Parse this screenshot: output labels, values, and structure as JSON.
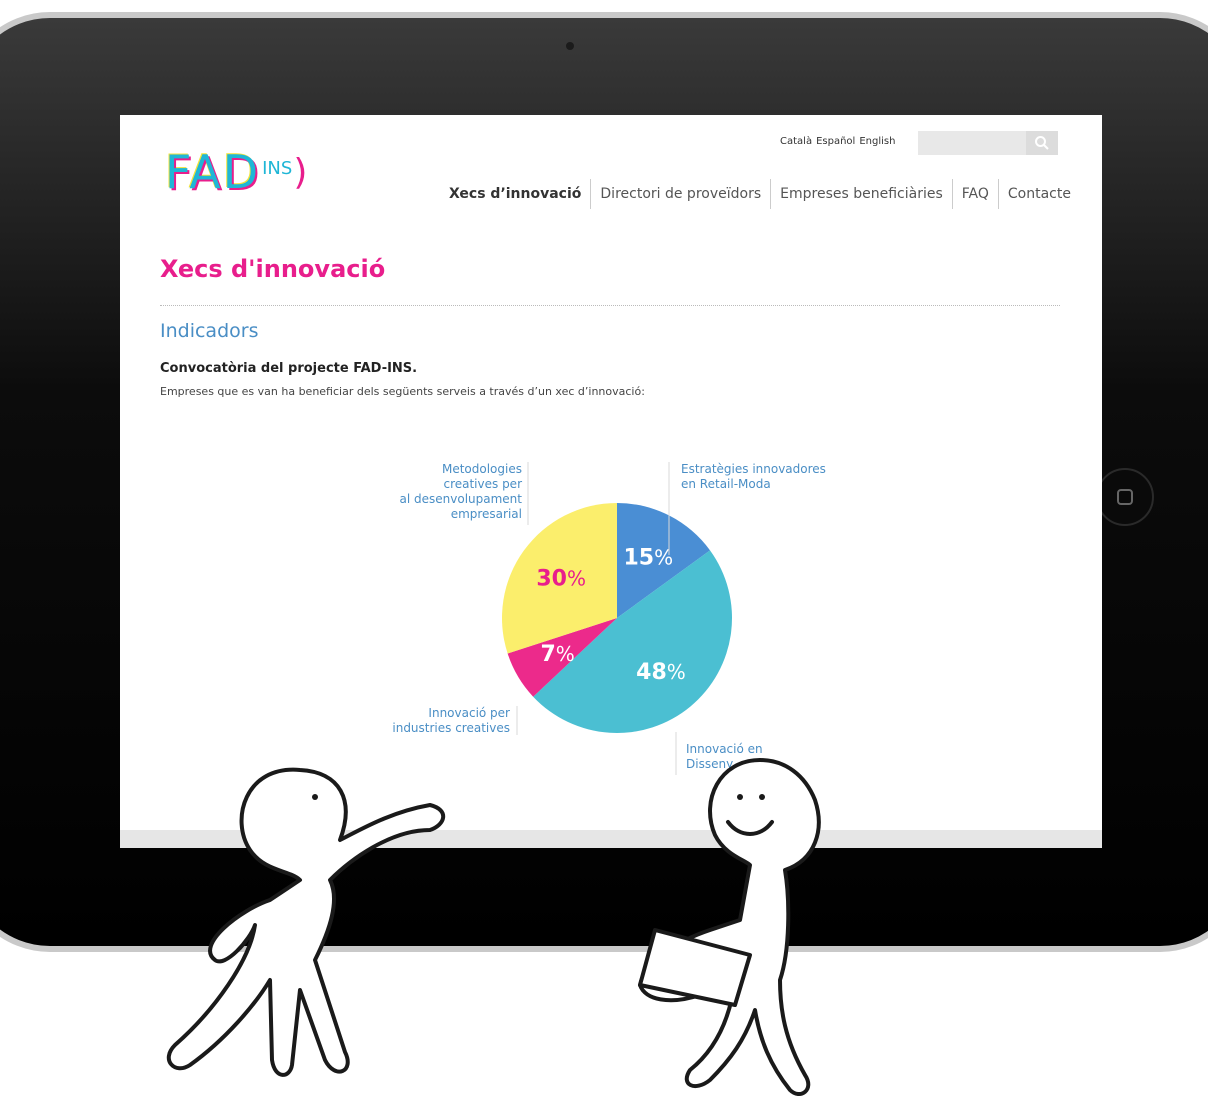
{
  "header": {
    "logo_main": "FAD",
    "logo_sub": "INS",
    "logo_paren": ")",
    "languages": [
      "Català",
      "Español",
      "English"
    ]
  },
  "nav": {
    "items": [
      "Xecs d’innovació",
      "Directori de proveïdors",
      "Empreses beneficiàries",
      "FAQ",
      "Contacte"
    ]
  },
  "page": {
    "title": "Xecs d'innovació",
    "section": "Indicadors",
    "subtitle": "Convocatòria del projecte FAD-INS.",
    "body": "Empreses que es van ha beneficiar dels següents serveis a través d’un xec d’innovació:"
  },
  "chart_data": {
    "type": "pie",
    "categories": [
      "Estratègies innovadores en Retail-Moda",
      "Innovació en Disseny",
      "Innovació per industries creatives",
      "Metodologies creatives per al desenvolupament empresarial"
    ],
    "values": [
      15,
      48,
      7,
      30
    ],
    "colors": [
      "#4a8ed4",
      "#4bbfd2",
      "#ec2a8b",
      "#fbee6c"
    ],
    "value_labels": [
      "15",
      "48",
      "7",
      "30"
    ],
    "unit": "%",
    "label_colors": [
      "#ffffff",
      "#ffffff",
      "#ffffff",
      "#e81e8c"
    ],
    "slice_labels": [
      [
        "Estratègies innovadores",
        "en Retail-Moda"
      ],
      [
        "Innovació en",
        "Disseny"
      ],
      [
        "Innovació per",
        "industries creatives"
      ],
      [
        "Metodologies",
        "creatives per",
        "al desenvolupament",
        "empresarial"
      ]
    ]
  }
}
